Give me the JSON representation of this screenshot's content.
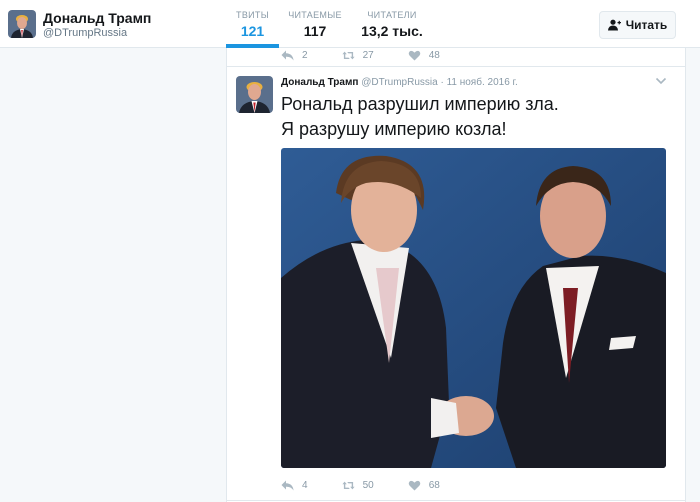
{
  "profile": {
    "name": "Дональд Трамп",
    "handle": "@DTrumpRussia"
  },
  "stats": [
    {
      "label": "ТВИТЫ",
      "value": "121",
      "active": true
    },
    {
      "label": "ЧИТАЕМЫЕ",
      "value": "117",
      "active": false
    },
    {
      "label": "ЧИТАТЕЛИ",
      "value": "13,2 тыс.",
      "active": false
    }
  ],
  "follow_button": {
    "label": "Читать",
    "icon": "add-user-icon"
  },
  "prev_tweet_actions": {
    "replies": "2",
    "retweets": "27",
    "likes": "48"
  },
  "tweet": {
    "author_name": "Дональд Трамп",
    "author_handle": "@DTrumpRussia",
    "time": "11 нояб. 2016 г.",
    "text_lines": [
      "Рональд разрушил империю зла.",
      "Я разрушу империю козла!"
    ],
    "actions": {
      "replies": "4",
      "retweets": "50",
      "likes": "68"
    }
  },
  "colors": {
    "accent": "#1b95e0",
    "muted": "#8899a6",
    "photo_bg": "#2a5288"
  },
  "icons": [
    "reply-icon",
    "retweet-icon",
    "heart-icon",
    "chevron-down-icon",
    "add-user-icon"
  ]
}
